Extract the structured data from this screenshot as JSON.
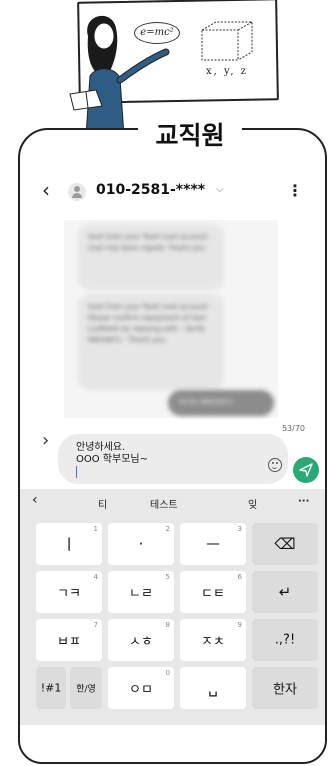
{
  "banner": {
    "label": "교직원",
    "formula": "e=mc²",
    "axes": "x, y, z"
  },
  "header": {
    "phone_number": "010-2581-****"
  },
  "messages": {
    "bubble1": "Sent from your Toshi mail account - Loan has been repaid. Thank you.",
    "bubble2": "Sent from your Toshi mail account - Please confirm repayment of loan LLOR04A by replying with - Verify M60SNY1 - Thank you.",
    "bubble3": "Verify M60SNY1",
    "counter": "53/70"
  },
  "input": {
    "value": "안녕하세요.\nOOO 학부모님~"
  },
  "keyboard": {
    "suggestions": [
      "티",
      "테스트",
      "잊"
    ],
    "rows": [
      [
        {
          "label": "ㅣ",
          "hint": "1"
        },
        {
          "label": "·",
          "hint": "2"
        },
        {
          "label": "ㅡ",
          "hint": "3"
        },
        {
          "label": "⌫",
          "hint": ""
        }
      ],
      [
        {
          "label": "ㄱㅋ",
          "hint": "4"
        },
        {
          "label": "ㄴㄹ",
          "hint": "5"
        },
        {
          "label": "ㄷㅌ",
          "hint": "6"
        },
        {
          "label": "↵",
          "hint": ""
        }
      ],
      [
        {
          "label": "ㅂㅍ",
          "hint": "7"
        },
        {
          "label": "ㅅㅎ",
          "hint": "8"
        },
        {
          "label": "ㅈㅊ",
          "hint": "9"
        },
        {
          "label": ".,?!",
          "hint": ""
        }
      ],
      [
        {
          "label": "!#1",
          "hint": ""
        },
        {
          "label": "한/영",
          "hint": ""
        },
        {
          "label": "ㅇㅁ",
          "hint": "0"
        },
        {
          "label": "␣",
          "hint": ""
        },
        {
          "label": "한자",
          "hint": ""
        }
      ]
    ]
  }
}
